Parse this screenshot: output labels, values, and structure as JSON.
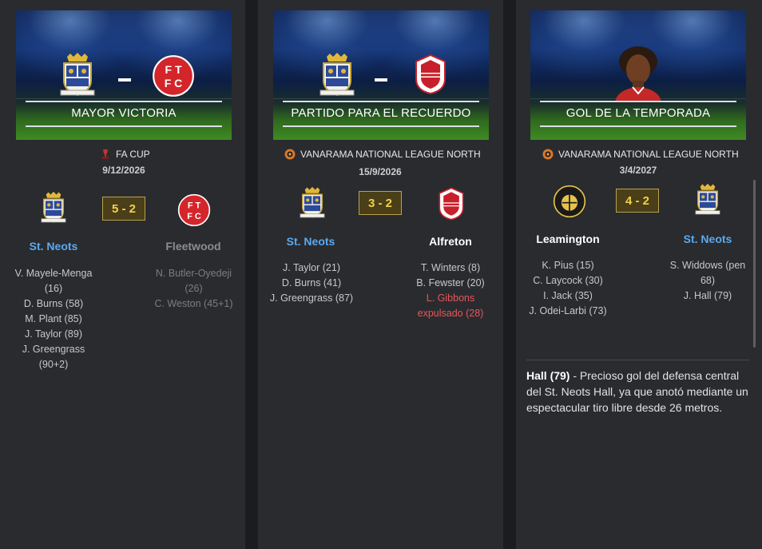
{
  "cards": [
    {
      "banner_title": "MAYOR VICTORIA",
      "competition": "FA CUP",
      "date": "9/12/2026",
      "score": "5 - 2",
      "home_team": "St. Neots",
      "away_team": "Fleetwood",
      "home_scorers": [
        "V. Mayele-Menga",
        "(16)",
        "D. Burns (58)",
        "M. Plant (85)",
        "J. Taylor (89)",
        "J. Greengrass",
        "(90+2)"
      ],
      "away_scorers": [
        "N. Butler-Oyedeji",
        "(26)",
        "C. Weston (45+1)"
      ]
    },
    {
      "banner_title": "PARTIDO PARA EL RECUERDO",
      "competition": "VANARAMA NATIONAL LEAGUE NORTH",
      "date": "15/9/2026",
      "score": "3 - 2",
      "home_team": "St. Neots",
      "away_team": "Alfreton",
      "home_scorers": [
        "J. Taylor (21)",
        "D. Burns (41)",
        "J. Greengrass (87)"
      ],
      "away_scorers": [
        "T. Winters (8)",
        "B. Fewster (20)"
      ],
      "away_red": [
        "L. Gibbons",
        "expulsado (28)"
      ]
    },
    {
      "banner_title": "GOL DE LA TEMPORADA",
      "competition": "VANARAMA NATIONAL LEAGUE NORTH",
      "date": "3/4/2027",
      "score": "4 - 2",
      "home_team": "Leamington",
      "away_team": "St. Neots",
      "home_scorers": [
        "K. Pius (15)",
        "C. Laycock (30)",
        "I. Jack (35)",
        "J. Odei-Larbi (73)"
      ],
      "away_scorers": [
        "S. Widdows (pen",
        "68)",
        "J. Hall (79)"
      ],
      "description_bold": "Hall (79)",
      "description_text": " - Precioso gol del defensa central del St. Neots Hall, ya que anotó mediante un espectacular tiro libre desde 26 metros."
    }
  ],
  "colors": {
    "home_blue": "#5aa9f0",
    "score_gold": "#f2d24a",
    "red_card": "#e8555a"
  },
  "icons": {
    "st_neots": "st-neots-crest-icon",
    "fleetwood": "fleetwood-crest-icon",
    "alfreton": "alfreton-crest-icon",
    "leamington": "leamington-crest-icon",
    "fa_cup": "fa-cup-icon",
    "vanarama": "vanarama-icon"
  }
}
